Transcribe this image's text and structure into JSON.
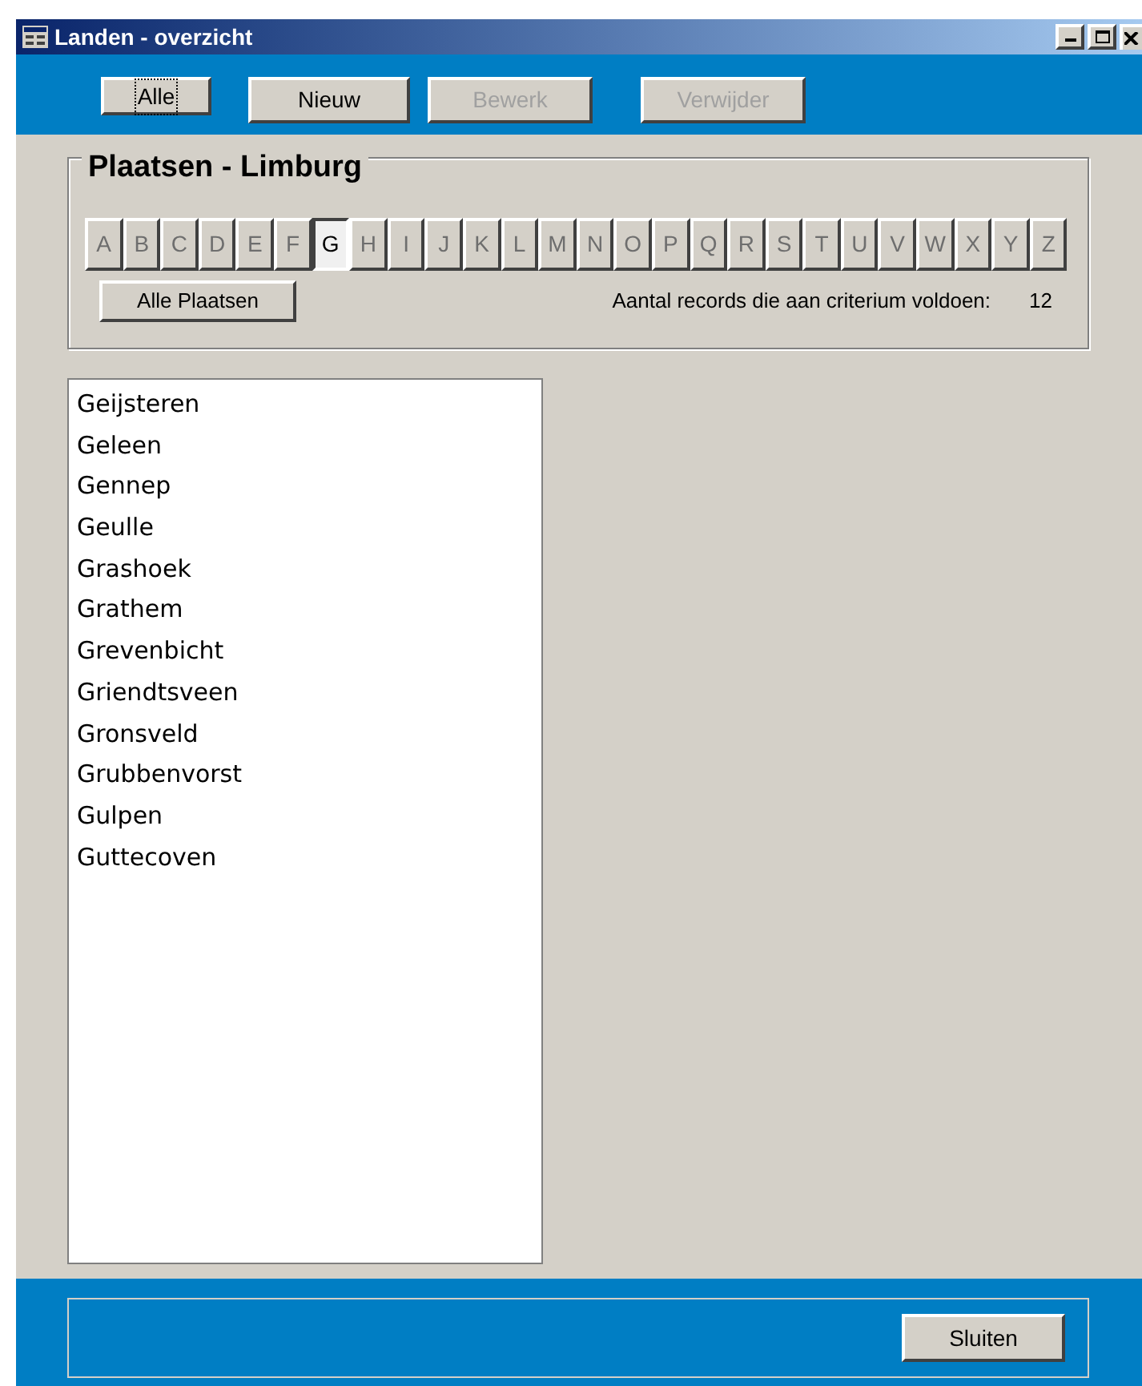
{
  "window": {
    "title": "Landen - overzicht"
  },
  "toolbar": [
    {
      "label": "Alle",
      "disabled": false,
      "focused": true
    },
    {
      "label": "Nieuw",
      "disabled": false,
      "focused": false
    },
    {
      "label": "Bewerk",
      "disabled": true,
      "focused": false
    },
    {
      "label": "Verwijder",
      "disabled": true,
      "focused": false
    }
  ],
  "group": {
    "title": "Plaatsen - Limburg",
    "letters": [
      {
        "label": "A",
        "selected": false,
        "disabled": true
      },
      {
        "label": "B",
        "selected": false,
        "disabled": true
      },
      {
        "label": "C",
        "selected": false,
        "disabled": true
      },
      {
        "label": "D",
        "selected": false,
        "disabled": true
      },
      {
        "label": "E",
        "selected": false,
        "disabled": true
      },
      {
        "label": "F",
        "selected": false,
        "disabled": true
      },
      {
        "label": "G",
        "selected": true,
        "disabled": false
      },
      {
        "label": "H",
        "selected": false,
        "disabled": true
      },
      {
        "label": "I",
        "selected": false,
        "disabled": true
      },
      {
        "label": "J",
        "selected": false,
        "disabled": true
      },
      {
        "label": "K",
        "selected": false,
        "disabled": true
      },
      {
        "label": "L",
        "selected": false,
        "disabled": true
      },
      {
        "label": "M",
        "selected": false,
        "disabled": true
      },
      {
        "label": "N",
        "selected": false,
        "disabled": true
      },
      {
        "label": "O",
        "selected": false,
        "disabled": true
      },
      {
        "label": "P",
        "selected": false,
        "disabled": true
      },
      {
        "label": "Q",
        "selected": false,
        "disabled": true
      },
      {
        "label": "R",
        "selected": false,
        "disabled": true
      },
      {
        "label": "S",
        "selected": false,
        "disabled": true
      },
      {
        "label": "T",
        "selected": false,
        "disabled": true
      },
      {
        "label": "U",
        "selected": false,
        "disabled": true
      },
      {
        "label": "V",
        "selected": false,
        "disabled": true
      },
      {
        "label": "W",
        "selected": false,
        "disabled": true
      },
      {
        "label": "X",
        "selected": false,
        "disabled": true
      },
      {
        "label": "Y",
        "selected": false,
        "disabled": true
      },
      {
        "label": "Z",
        "selected": false,
        "disabled": true
      }
    ],
    "all_button": "Alle Plaatsen",
    "count_label": "Aantal records die aan criterium voldoen:",
    "count": "12"
  },
  "places": [
    "Geijsteren",
    "Geleen",
    "Gennep",
    "Geulle",
    "Grashoek",
    "Grathem",
    "Grevenbicht",
    "Griendtsveen",
    "Gronsveld",
    "Grubbenvorst",
    "Gulpen",
    "Guttecoven"
  ],
  "footer": {
    "button": "Sluiten"
  }
}
